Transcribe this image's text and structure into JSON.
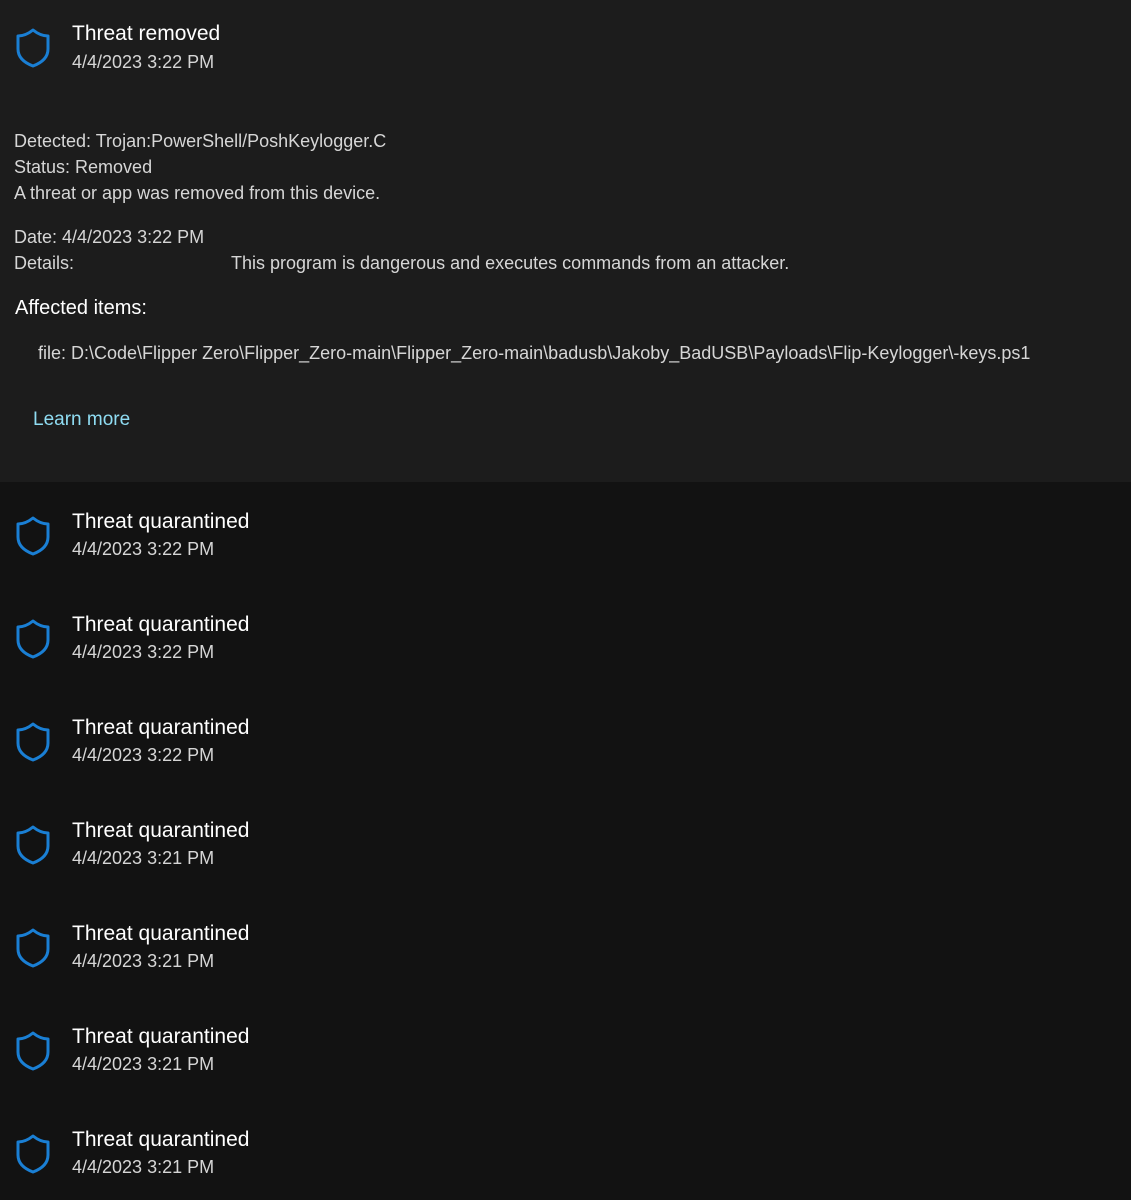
{
  "expanded": {
    "title": "Threat removed",
    "date": "4/4/2023 3:22 PM",
    "detected_label": "Detected:",
    "detected_value": "Trojan:PowerShell/PoshKeylogger.C",
    "status_label": "Status:",
    "status_value": "Removed",
    "description": "A threat or app was removed from this device.",
    "date_label": "Date:",
    "date_value": "4/4/2023 3:22 PM",
    "details_label": "Details:",
    "details_value": "This program is dangerous and executes commands from an attacker.",
    "affected_title": "Affected items:",
    "affected_item": "file: D:\\Code\\Flipper Zero\\Flipper_Zero-main\\Flipper_Zero-main\\badusb\\Jakoby_BadUSB\\Payloads\\Flip-Keylogger\\-keys.ps1",
    "learn_more": "Learn more"
  },
  "history": [
    {
      "title": "Threat quarantined",
      "date": "4/4/2023 3:22 PM"
    },
    {
      "title": "Threat quarantined",
      "date": "4/4/2023 3:22 PM"
    },
    {
      "title": "Threat quarantined",
      "date": "4/4/2023 3:22 PM"
    },
    {
      "title": "Threat quarantined",
      "date": "4/4/2023 3:21 PM"
    },
    {
      "title": "Threat quarantined",
      "date": "4/4/2023 3:21 PM"
    },
    {
      "title": "Threat quarantined",
      "date": "4/4/2023 3:21 PM"
    },
    {
      "title": "Threat quarantined",
      "date": "4/4/2023 3:21 PM"
    }
  ],
  "icons": {
    "entry_icon": "shield-icon"
  },
  "colors": {
    "accent": "#1a7fd4",
    "link": "#8fdcf2"
  }
}
